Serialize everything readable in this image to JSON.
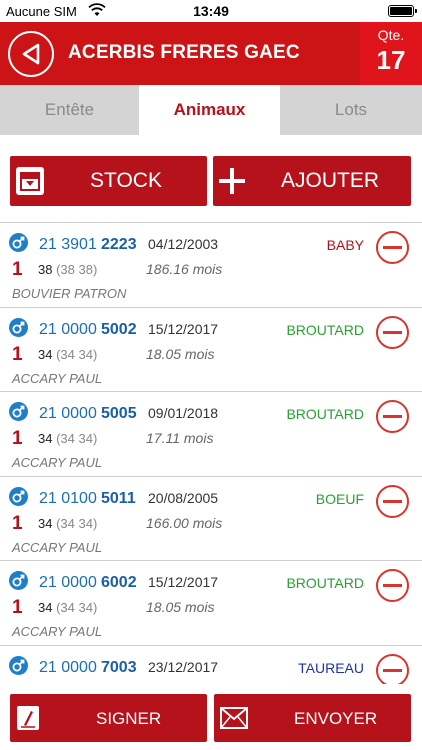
{
  "status_bar": {
    "carrier": "Aucune SIM",
    "time": "13:49"
  },
  "header": {
    "title": "ACERBIS FRERES GAEC",
    "qte_label": "Qte.",
    "qte_value": "17"
  },
  "tabs": [
    {
      "label": "Entête"
    },
    {
      "label": "Animaux"
    },
    {
      "label": "Lots"
    }
  ],
  "actions": {
    "stock_label": "STOCK",
    "add_label": "AJOUTER"
  },
  "animals": [
    {
      "id_prefix": "21 3901",
      "id_suffix": "2223",
      "date": "04/12/2003",
      "category": "BABY",
      "category_color": "#b5121b",
      "num": "1",
      "weight": "38",
      "weight_detail": "(38 38)",
      "age": "186.16 mois",
      "owner": "BOUVIER PATRON"
    },
    {
      "id_prefix": "21 0000",
      "id_suffix": "5002",
      "date": "15/12/2017",
      "category": "BROUTARD",
      "category_color": "#2aa034",
      "num": "1",
      "weight": "34",
      "weight_detail": "(34 34)",
      "age": "18.05 mois",
      "owner": "ACCARY PAUL"
    },
    {
      "id_prefix": "21 0000",
      "id_suffix": "5005",
      "date": "09/01/2018",
      "category": "BROUTARD",
      "category_color": "#2aa034",
      "num": "1",
      "weight": "34",
      "weight_detail": "(34 34)",
      "age": "17.11 mois",
      "owner": "ACCARY PAUL"
    },
    {
      "id_prefix": "21 0100",
      "id_suffix": "5011",
      "date": "20/08/2005",
      "category": "BOEUF",
      "category_color": "#2aa034",
      "num": "1",
      "weight": "34",
      "weight_detail": "(34 34)",
      "age": "166.00 mois",
      "owner": "ACCARY PAUL"
    },
    {
      "id_prefix": "21 0000",
      "id_suffix": "6002",
      "date": "15/12/2017",
      "category": "BROUTARD",
      "category_color": "#2aa034",
      "num": "1",
      "weight": "34",
      "weight_detail": "(34 34)",
      "age": "18.05 mois",
      "owner": "ACCARY PAUL"
    },
    {
      "id_prefix": "21 0000",
      "id_suffix": "7003",
      "date": "23/12/2017",
      "category": "TAUREAU",
      "category_color": "#1f33a8",
      "num": "",
      "weight": "",
      "weight_detail": "",
      "age": "",
      "owner": ""
    }
  ],
  "footer": {
    "sign_label": "SIGNER",
    "send_label": "ENVOYER"
  },
  "colors": {
    "brand": "#cc1417",
    "button": "#b5121b",
    "sex_male": "#1e7fc8"
  },
  "icons": {
    "back": "back-arrow-icon",
    "stock": "archive-box-icon",
    "add": "plus-icon",
    "remove": "remove-circle-icon",
    "sex": "male-symbol-icon",
    "sign": "signature-icon",
    "send": "envelope-icon"
  }
}
